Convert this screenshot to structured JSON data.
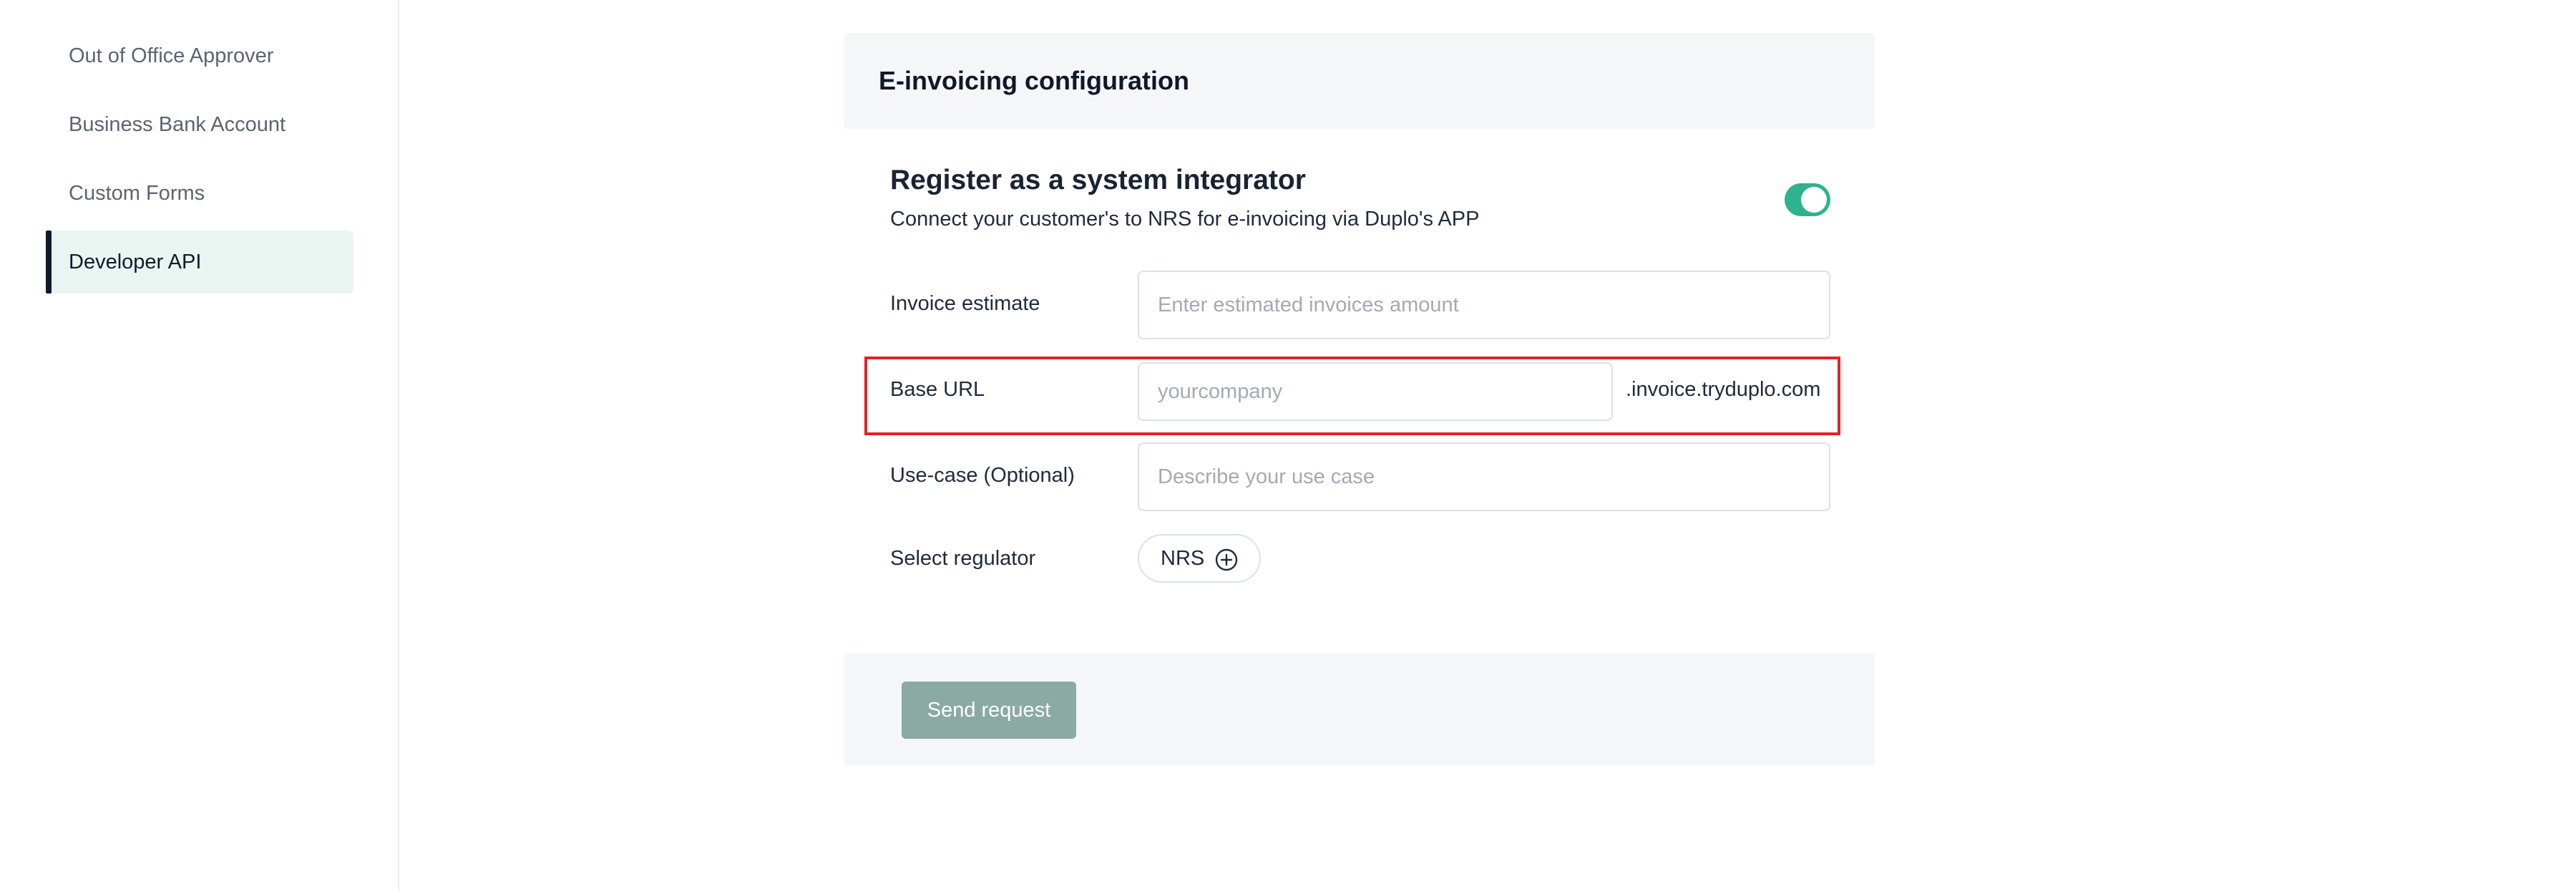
{
  "sidebar": {
    "items": [
      {
        "label": "Out of Office Approver"
      },
      {
        "label": "Business Bank Account"
      },
      {
        "label": "Custom Forms"
      },
      {
        "label": "Developer API",
        "active": true
      }
    ]
  },
  "config": {
    "header": "E-invoicing configuration",
    "integrator_title": "Register as a system integrator",
    "integrator_subtitle": "Connect your customer's to NRS for e-invoicing via Duplo's APP",
    "toggle_on": true
  },
  "form": {
    "invoice_estimate": {
      "label": "Invoice estimate",
      "value": "",
      "placeholder": "Enter estimated invoices amount"
    },
    "base_url": {
      "label": "Base URL",
      "value": "",
      "placeholder": "yourcompany",
      "suffix": ".invoice.tryduplo.com"
    },
    "use_case": {
      "label": "Use-case (Optional)",
      "value": "",
      "placeholder": "Describe your use case"
    },
    "regulator": {
      "label": "Select regulator",
      "chip": "NRS",
      "chip_icon": "plus-circle-icon"
    }
  },
  "footer": {
    "send_label": "Send request"
  },
  "colors": {
    "accent": "#2fb28e",
    "button_disabled": "#8aaaa2",
    "highlight": "#e02424",
    "active_nav_bg": "#eaf5f2"
  }
}
